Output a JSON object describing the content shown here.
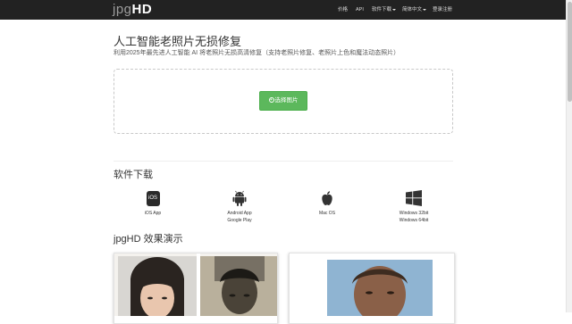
{
  "brand": {
    "part1": "jpg",
    "part2": "HD"
  },
  "nav": {
    "price": "价格",
    "api": "API",
    "download": "软件下载",
    "language": "简体中文",
    "login": "登录注册"
  },
  "hero": {
    "title": "人工智能老照片无损修复",
    "subtitle": "利用2025年最先进人工智能 AI 将老照片无损高清修复（支持老照片修复、老照片上色和魔法动态照片）",
    "choose_label": "选择图片"
  },
  "downloads": {
    "heading": "软件下载",
    "items": [
      {
        "icon": "ios-icon",
        "icon_text": "iOS",
        "line1": "iOS App",
        "line2": ""
      },
      {
        "icon": "android-icon",
        "line1": "Android App",
        "line2": "Google Play"
      },
      {
        "icon": "apple-icon",
        "line1": "Mac OS",
        "line2": ""
      },
      {
        "icon": "windows-icon",
        "line1": "Windows 32bit",
        "line2": "Windows 64bit"
      }
    ]
  },
  "demo": {
    "heading": "jpgHD 效果演示"
  },
  "colors": {
    "navbar": "#222222",
    "accent_green": "#5cb85c"
  }
}
